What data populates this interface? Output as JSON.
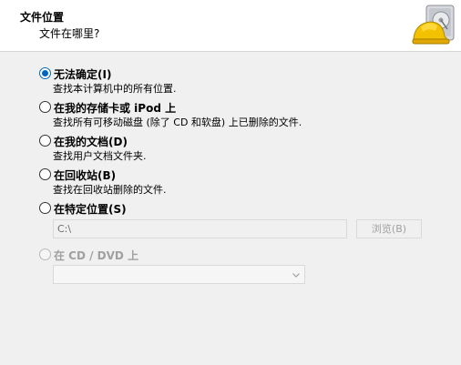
{
  "header": {
    "title": "文件位置",
    "subtitle": "文件在哪里?",
    "icon": "hard-hat-disk-icon"
  },
  "options": [
    {
      "label": "无法确定(I)",
      "description": "查找本计算机中的所有位置.",
      "checked": true,
      "enabled": true
    },
    {
      "label": "在我的存储卡或 iPod 上",
      "description": "查找所有可移动磁盘 (除了 CD 和软盘) 上已删除的文件.",
      "checked": false,
      "enabled": true
    },
    {
      "label": "在我的文档(D)",
      "description": "查找用户文档文件夹.",
      "checked": false,
      "enabled": true
    },
    {
      "label": "在回收站(B)",
      "description": "查找在回收站删除的文件.",
      "checked": false,
      "enabled": true
    },
    {
      "label": "在特定位置(S)",
      "checked": false,
      "enabled": true
    },
    {
      "label": "在 CD / DVD 上",
      "checked": false,
      "enabled": false
    }
  ],
  "specific_location": {
    "value": "C:\\",
    "browse_label": "浏览(B)"
  },
  "drive_select": {
    "value": ""
  },
  "colors": {
    "accent": "#0067c0",
    "disabled_text": "#a0a0a0",
    "header_bg": "#ffffff",
    "body_bg": "#f0f0f0"
  }
}
